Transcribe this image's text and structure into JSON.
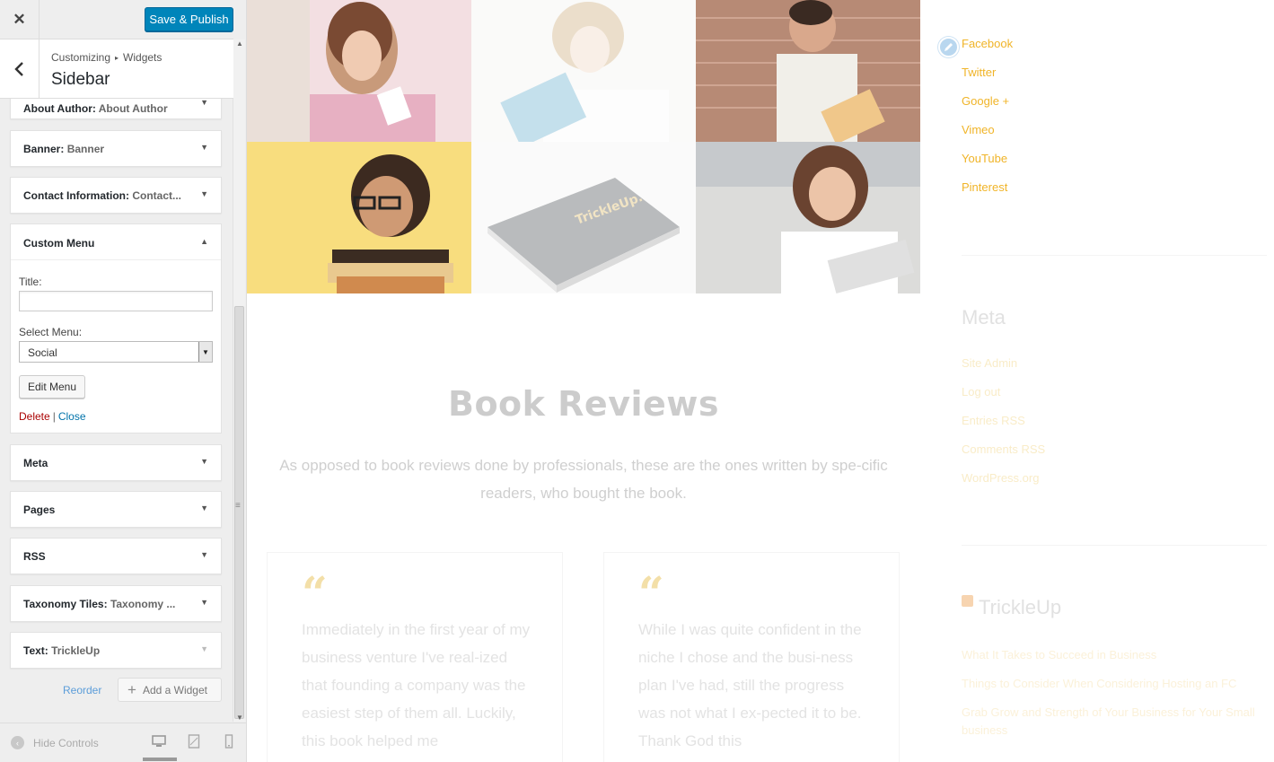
{
  "topbar": {
    "close_glyph": "✕",
    "save_label": "Save & Publish"
  },
  "section": {
    "breadcrumb_root": "Customizing",
    "breadcrumb_sep": "▸",
    "breadcrumb_leaf": "Widgets",
    "title": "Sidebar"
  },
  "widgets": [
    {
      "name": "About Author:",
      "sub": "About Author",
      "caret": "▼"
    },
    {
      "name": "Banner:",
      "sub": "Banner",
      "caret": "▼"
    },
    {
      "name": "Contact Information:",
      "sub": "Contact...",
      "caret": "▼"
    },
    {
      "name": "Meta",
      "sub": "",
      "caret": "▼"
    },
    {
      "name": "Pages",
      "sub": "",
      "caret": "▼"
    },
    {
      "name": "RSS",
      "sub": "",
      "caret": "▼"
    },
    {
      "name": "Taxonomy Tiles:",
      "sub": "Taxonomy ...",
      "caret": "▼"
    },
    {
      "name": "Text:",
      "sub": "TrickleUp",
      "caret": "▼"
    }
  ],
  "custom_menu": {
    "name": "Custom Menu",
    "caret": "▲",
    "title_label": "Title:",
    "title_value": "",
    "select_label": "Select Menu:",
    "select_value": "Social",
    "select_arrow": "▼",
    "edit_label": "Edit Menu",
    "delete_label": "Delete",
    "separator": "|",
    "close_label": "Close"
  },
  "footer": {
    "reorder_label": "Reorder",
    "add_widget_plus": "+",
    "add_widget_label": "Add a Widget",
    "hide_controls_label": "Hide Controls",
    "hide_controls_glyph": "‹"
  },
  "scroll": {
    "up": "▲",
    "down": "▼",
    "handle": "≡"
  },
  "preview": {
    "reviews_title": "Book Reviews",
    "reviews_sub": "As opposed to book reviews done by professionals, these are the ones written by spe-cific readers, who bought the book.",
    "quote_glyph": "“",
    "review_1": "Immediately in the first year of my business venture I've real-ized that founding a company was the easiest step of them all. Luckily, this book helped me",
    "review_2": "While I was quite confident in the niche I chose and the busi-ness plan I've had, still the progress was not what I ex-pected it to be. Thank God this",
    "book_cover_text": "TrickleUp.",
    "social_links": [
      "Facebook",
      "Twitter",
      "Google +",
      "Vimeo",
      "YouTube",
      "Pinterest"
    ],
    "meta_title": "Meta",
    "meta_links": [
      "Site Admin",
      "Log out",
      "Entries RSS",
      "Comments RSS",
      "WordPress.org"
    ],
    "rss_title": "TrickleUp",
    "rss_links": [
      "What It Takes to Succeed in Business",
      "Things to Consider When Considering Hosting an FC",
      "Grab Grow and Strength of Your Business for Your Small business"
    ]
  },
  "colors": {
    "accent": "#0085ba",
    "link_gold": "#f0b428",
    "delete_red": "#a00",
    "close_blue": "#0073aa"
  },
  "icons": {
    "close": "close-icon",
    "back": "chevron-left-icon",
    "edit": "pencil-icon",
    "rss": "rss-icon",
    "desktop": "desktop-icon",
    "tablet": "tablet-icon",
    "mobile": "mobile-icon",
    "plus": "plus-icon"
  }
}
